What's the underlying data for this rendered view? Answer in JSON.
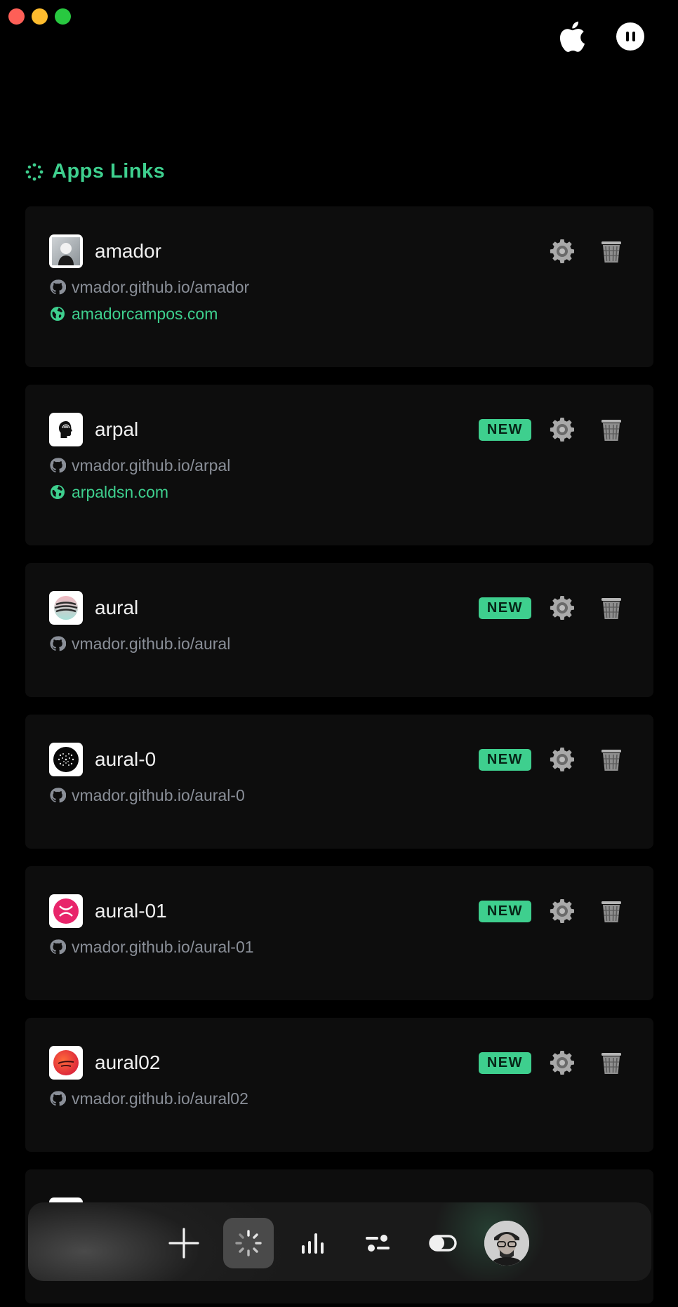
{
  "window": {
    "controls": [
      "close",
      "minimize",
      "maximize"
    ]
  },
  "header": {
    "platform_icon": "apple-icon",
    "pause_icon": "pause-icon"
  },
  "section": {
    "title": "Apps Links",
    "icon": "dots-grid-icon",
    "accent": "#3ecf8e"
  },
  "apps": [
    {
      "name": "amador",
      "is_new": false,
      "badge": "",
      "github": "vmador.github.io/amador",
      "website": "amadorcampos.com",
      "icon": "portrait-icon"
    },
    {
      "name": "arpal",
      "is_new": true,
      "badge": "NEW",
      "github": "vmador.github.io/arpal",
      "website": "arpaldsn.com",
      "icon": "head-fingerprint-icon"
    },
    {
      "name": "aural",
      "is_new": true,
      "badge": "NEW",
      "github": "vmador.github.io/aural",
      "website": "",
      "icon": "gradient-waves-icon"
    },
    {
      "name": "aural-0",
      "is_new": true,
      "badge": "NEW",
      "github": "vmador.github.io/aural-0",
      "website": "",
      "icon": "dot-sphere-icon"
    },
    {
      "name": "aural-01",
      "is_new": true,
      "badge": "NEW",
      "github": "vmador.github.io/aural-01",
      "website": "",
      "icon": "pink-x-icon"
    },
    {
      "name": "aural02",
      "is_new": true,
      "badge": "NEW",
      "github": "vmador.github.io/aural02",
      "website": "",
      "icon": "red-orb-icon"
    }
  ],
  "dock": {
    "items": [
      "plus-icon",
      "loader-icon",
      "bar-chart-icon",
      "sliders-icon",
      "toggle-icon",
      "avatar"
    ],
    "active": "loader-icon"
  }
}
